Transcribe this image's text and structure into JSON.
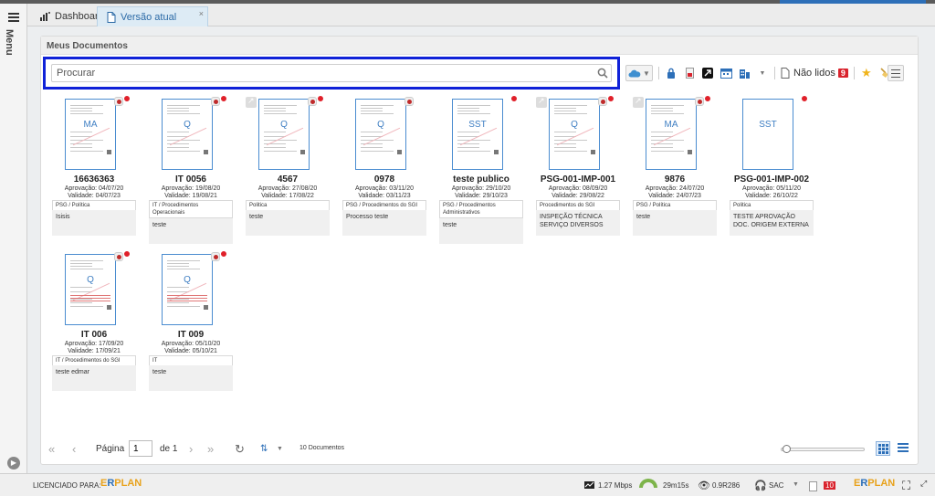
{
  "sidebar": {
    "menu_label": "Menu"
  },
  "tabs": [
    {
      "label": "Dashboard"
    },
    {
      "label": "Versão atual",
      "close": "×"
    }
  ],
  "panel": {
    "title": "Meus Documentos",
    "search": {
      "placeholder": "Procurar"
    },
    "toolbar": {
      "unread_label": "Não lidos",
      "unread_count": "9"
    }
  },
  "documents": [
    {
      "thumb_code": "MA",
      "title": "16636363",
      "approval": "Aprovação: 04/07/20",
      "validity": "Validade: 04/07/23",
      "category": "PSG / Política",
      "description": "Isisis"
    },
    {
      "thumb_code": "Q",
      "title": "IT 0056",
      "approval": "Aprovação: 19/08/20",
      "validity": "Validade: 19/08/21",
      "category": "IT / Procedimentos Operacionais",
      "description": "teste"
    },
    {
      "thumb_code": "Q",
      "title": "4567",
      "approval": "Aprovação: 27/08/20",
      "validity": "Validade: 17/08/22",
      "category": "Politica",
      "description": "teste"
    },
    {
      "thumb_code": "Q",
      "title": "0978",
      "approval": "Aprovação: 03/11/20",
      "validity": "Validade: 03/11/23",
      "category": "PSG / Procedimentos do SGI",
      "description": "Processo teste"
    },
    {
      "thumb_code": "SST",
      "title": "teste publico",
      "approval": "Aprovação: 29/10/20",
      "validity": "Validade: 29/10/23",
      "category": "PSG / Procedimentos Administrativos",
      "description": "teste"
    },
    {
      "thumb_code": "Q",
      "title": "PSG-001-IMP-001",
      "approval": "Aprovação: 08/09/20",
      "validity": "Validade: 29/08/22",
      "category": "Procedimentos do SGI",
      "description": "INSPEÇÃO TÉCNICA SERVIÇO DIVERSOS"
    },
    {
      "thumb_code": "MA",
      "title": "9876",
      "approval": "Aprovação: 24/07/20",
      "validity": "Validade: 24/07/23",
      "category": "PSG / Política",
      "description": "teste"
    },
    {
      "thumb_code": "SST",
      "title": "PSG-001-IMP-002",
      "approval": "Aprovação: 05/11/20",
      "validity": "Validade: 26/10/22",
      "category": "Politica",
      "description": "TESTE APROVAÇÃO DOC. ORIGEM EXTERNA"
    },
    {
      "thumb_code": "Q",
      "title": "IT 006",
      "approval": "Aprovação: 17/09/20",
      "validity": "Validade: 17/09/21",
      "category": "IT / Procedimentos do SGI",
      "description": "teste edmar"
    },
    {
      "thumb_code": "Q",
      "title": "IT 009",
      "approval": "Aprovação: 05/10/20",
      "validity": "Validade: 05/10/21",
      "category": "IT",
      "description": "teste"
    }
  ],
  "pager": {
    "page_label": "Página",
    "current_page": "1",
    "of_label": "de 1",
    "total_label": "10 Documentos"
  },
  "statusbar": {
    "licensed_label": "LICENCIADO PARA:",
    "logo_e": "E",
    "logo_r": "R",
    "logo_plan": "PLAN",
    "speed": "1.27 Mbps",
    "timer": "29m15s",
    "version": "0.9R286",
    "sac": "SAC",
    "notif_count": "10"
  }
}
